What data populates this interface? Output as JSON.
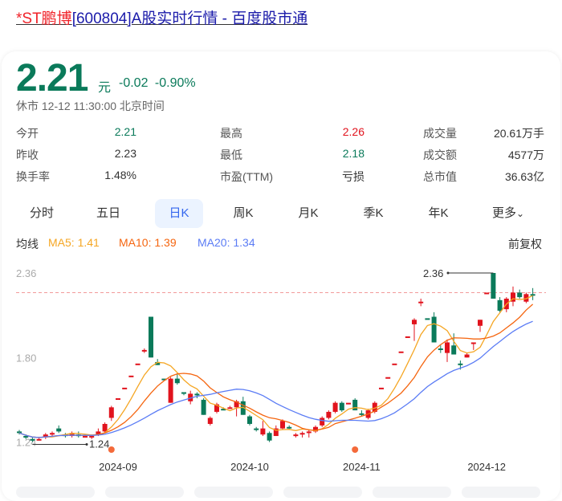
{
  "title": {
    "stock": "*ST鹏博",
    "rest": "[600804]A股实时行情 - 百度股市通"
  },
  "quote": {
    "price": "2.21",
    "unit": "元",
    "change": "-0.02",
    "change_pct": "-0.90%",
    "status": "休市 12-12 11:30:00 北京时间"
  },
  "stats": [
    {
      "label": "今开",
      "value": "2.21",
      "color": "green"
    },
    {
      "label": "最高",
      "value": "2.26",
      "color": "red"
    },
    {
      "label": "成交量",
      "value": "20.61万手",
      "color": "plain"
    },
    {
      "label": "昨收",
      "value": "2.23",
      "color": "plain"
    },
    {
      "label": "最低",
      "value": "2.18",
      "color": "green"
    },
    {
      "label": "成交额",
      "value": "4577万",
      "color": "plain"
    },
    {
      "label": "换手率",
      "value": "1.48%",
      "color": "plain"
    },
    {
      "label": "市盈(TTM)",
      "value": "亏损",
      "color": "plain"
    },
    {
      "label": "总市值",
      "value": "36.63亿",
      "color": "plain"
    }
  ],
  "tabs": [
    "分时",
    "五日",
    "日K",
    "周K",
    "月K",
    "季K",
    "年K",
    "更多"
  ],
  "active_tab": "日K",
  "ma": {
    "label": "均线",
    "ma5": "MA5: 1.41",
    "ma10": "MA10: 1.39",
    "ma20": "MA20: 1.34",
    "adjust": "前复权"
  },
  "colors": {
    "up": "#e1131d",
    "down": "#0a7a5a",
    "ma5": "#f5a623",
    "ma10": "#f5650f",
    "ma20": "#5b7cf5"
  },
  "chart_data": {
    "type": "candlestick",
    "y_ticks": [
      "2.36",
      "1.80",
      "1.24"
    ],
    "ylim": [
      1.24,
      2.36
    ],
    "prev_close": 2.23,
    "max_label": "2.36",
    "min_label": "1.24",
    "max_index": 72,
    "min_index": 2,
    "x_ticks": [
      {
        "label": "2024-09",
        "index": 15
      },
      {
        "label": "2024-10",
        "index": 35
      },
      {
        "label": "2024-11",
        "index": 52
      },
      {
        "label": "2024-12",
        "index": 71
      }
    ],
    "event_markers": [
      14,
      51
    ],
    "ohlc": [
      [
        1.31,
        1.3,
        1.32,
        1.29
      ],
      [
        1.28,
        1.27,
        1.29,
        1.26
      ],
      [
        1.26,
        1.25,
        1.27,
        1.24
      ],
      [
        1.26,
        1.26,
        1.27,
        1.25
      ],
      [
        1.27,
        1.29,
        1.3,
        1.26
      ],
      [
        1.29,
        1.3,
        1.31,
        1.28
      ],
      [
        1.33,
        1.31,
        1.35,
        1.3
      ],
      [
        1.29,
        1.29,
        1.3,
        1.27
      ],
      [
        1.28,
        1.3,
        1.31,
        1.27
      ],
      [
        1.29,
        1.28,
        1.31,
        1.27
      ],
      [
        1.28,
        1.28,
        1.29,
        1.27
      ],
      [
        1.27,
        1.28,
        1.29,
        1.26
      ],
      [
        1.29,
        1.31,
        1.33,
        1.28
      ],
      [
        1.31,
        1.36,
        1.37,
        1.3
      ],
      [
        1.4,
        1.47,
        1.48,
        1.38
      ],
      [
        1.53,
        1.53,
        1.53,
        1.53
      ],
      [
        1.6,
        1.6,
        1.6,
        1.6
      ],
      [
        1.68,
        1.68,
        1.68,
        1.68
      ],
      [
        1.76,
        1.76,
        1.76,
        1.76
      ],
      [
        1.85,
        1.85,
        1.86,
        1.83
      ],
      [
        2.07,
        1.8,
        2.07,
        1.8
      ],
      [
        1.77,
        1.75,
        1.79,
        1.75
      ],
      [
        1.66,
        1.66,
        1.66,
        1.66
      ],
      [
        1.5,
        1.66,
        1.67,
        1.5
      ],
      [
        1.66,
        1.63,
        1.69,
        1.62
      ],
      [
        1.57,
        1.56,
        1.57,
        1.55
      ],
      [
        1.51,
        1.56,
        1.58,
        1.49
      ],
      [
        1.56,
        1.55,
        1.57,
        1.53
      ],
      [
        1.52,
        1.42,
        1.53,
        1.42
      ],
      [
        1.36,
        1.4,
        1.41,
        1.35
      ],
      [
        1.44,
        1.49,
        1.5,
        1.43
      ],
      [
        1.46,
        1.46,
        1.47,
        1.45
      ],
      [
        1.47,
        1.47,
        1.48,
        1.46
      ],
      [
        1.47,
        1.51,
        1.52,
        1.41
      ],
      [
        1.51,
        1.42,
        1.54,
        1.42
      ],
      [
        1.41,
        1.36,
        1.42,
        1.35
      ],
      [
        1.33,
        1.32,
        1.34,
        1.31
      ],
      [
        1.29,
        1.33,
        1.38,
        1.28
      ],
      [
        1.3,
        1.25,
        1.31,
        1.24
      ],
      [
        1.28,
        1.33,
        1.35,
        1.28
      ],
      [
        1.33,
        1.38,
        1.39,
        1.32
      ],
      [
        1.34,
        1.33,
        1.35,
        1.32
      ],
      [
        1.28,
        1.29,
        1.3,
        1.27
      ],
      [
        1.29,
        1.3,
        1.31,
        1.27
      ],
      [
        1.3,
        1.31,
        1.32,
        1.27
      ],
      [
        1.31,
        1.34,
        1.35,
        1.3
      ],
      [
        1.35,
        1.4,
        1.41,
        1.34
      ],
      [
        1.4,
        1.44,
        1.45,
        1.39
      ],
      [
        1.44,
        1.5,
        1.51,
        1.43
      ],
      [
        1.5,
        1.45,
        1.51,
        1.44
      ],
      [
        1.5,
        1.5,
        1.5,
        1.5
      ],
      [
        1.52,
        1.45,
        1.53,
        1.45
      ],
      [
        1.43,
        1.42,
        1.45,
        1.41
      ],
      [
        1.4,
        1.45,
        1.46,
        1.39
      ],
      [
        1.44,
        1.5,
        1.51,
        1.43
      ],
      [
        1.6,
        1.6,
        1.6,
        1.6
      ],
      [
        1.67,
        1.67,
        1.67,
        1.67
      ],
      [
        1.76,
        1.76,
        1.76,
        1.76
      ],
      [
        1.84,
        1.84,
        1.84,
        1.84
      ],
      [
        1.94,
        1.94,
        1.94,
        1.94
      ],
      [
        2.02,
        2.05,
        2.06,
        1.91
      ],
      [
        2.17,
        2.17,
        2.19,
        2.14
      ],
      [
        2.06,
        2.06,
        2.06,
        2.06
      ],
      [
        2.07,
        1.9,
        2.1,
        1.9
      ],
      [
        1.86,
        1.86,
        1.88,
        1.83
      ],
      [
        1.83,
        1.9,
        1.92,
        1.77
      ],
      [
        1.88,
        1.82,
        1.96,
        1.82
      ],
      [
        1.76,
        1.75,
        1.78,
        1.72
      ],
      [
        1.8,
        1.82,
        1.83,
        1.8
      ],
      [
        1.9,
        1.9,
        1.9,
        1.85
      ],
      [
        2.01,
        2.05,
        2.05,
        1.97
      ],
      [
        2.23,
        2.23,
        2.23,
        2.23
      ],
      [
        2.36,
        2.19,
        2.36,
        2.19
      ],
      [
        2.18,
        2.11,
        2.2,
        2.1
      ],
      [
        2.12,
        2.19,
        2.2,
        2.1
      ],
      [
        2.17,
        2.23,
        2.27,
        2.14
      ],
      [
        2.23,
        2.2,
        2.25,
        2.19
      ],
      [
        2.17,
        2.22,
        2.23,
        2.16
      ],
      [
        2.22,
        2.21,
        2.26,
        2.18
      ]
    ]
  }
}
